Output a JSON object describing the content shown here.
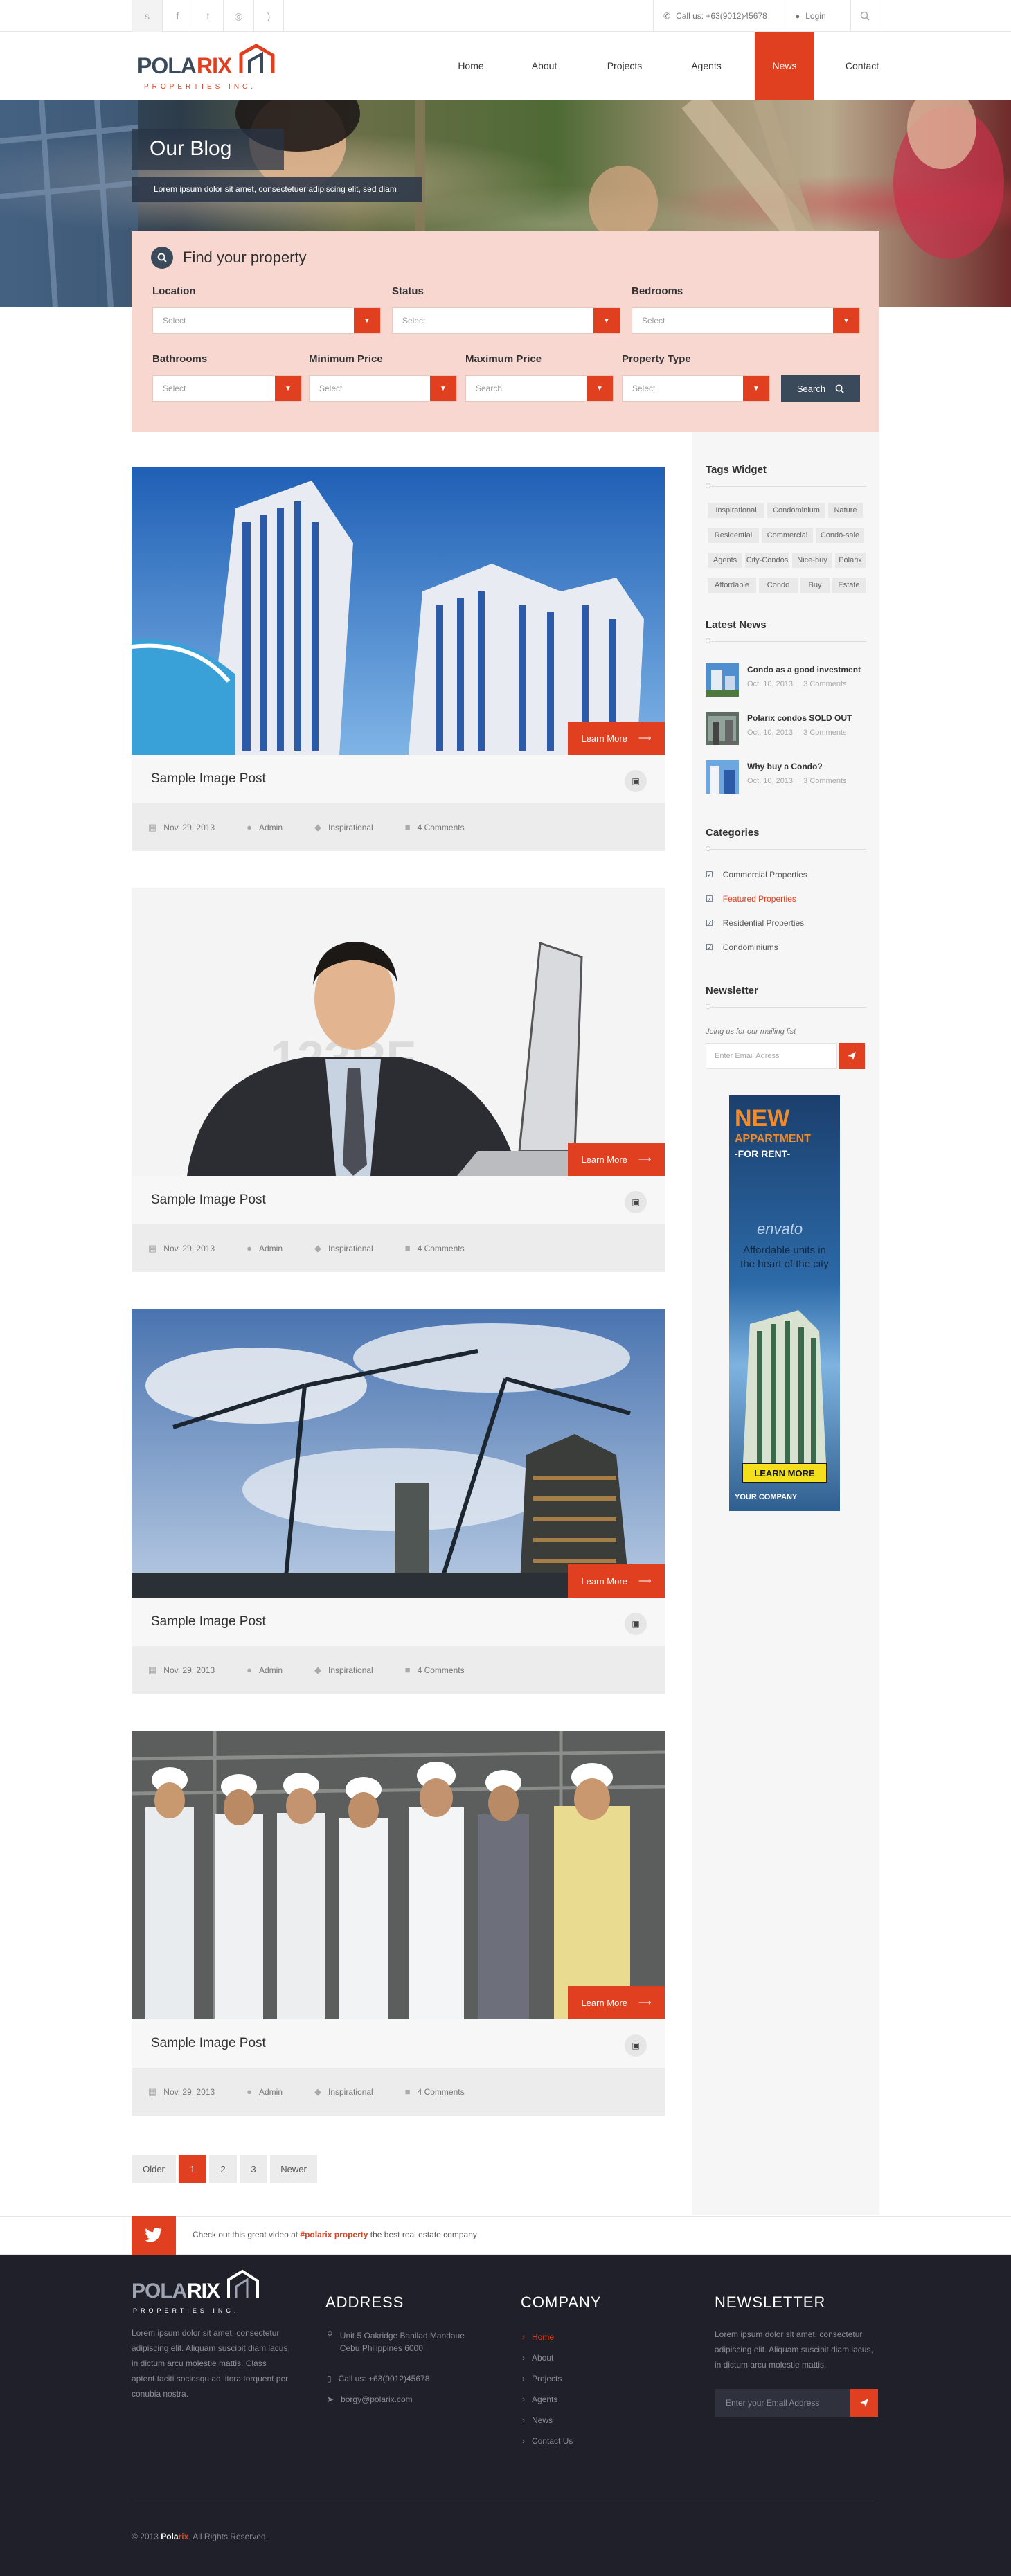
{
  "topbar": {
    "social_icons": [
      "skype-icon",
      "facebook-icon",
      "twitter-icon",
      "instagram-icon",
      "rss-icon"
    ],
    "call_label": "Call us: +63(9012)45678",
    "login_label": "Login"
  },
  "logo": {
    "name": "POLARIX",
    "sub": "PROPERTIES INC."
  },
  "nav": [
    "Home",
    "About",
    "Projects",
    "Agents",
    "News",
    "Contact"
  ],
  "hero": {
    "title": "Our Blog",
    "subtitle": "Lorem ipsum dolor sit amet, consectetuer adipiscing elit, sed diam"
  },
  "search": {
    "heading": "Find your property",
    "fields": [
      {
        "label": "Location",
        "value": "Select"
      },
      {
        "label": "Status",
        "value": "Select"
      },
      {
        "label": "Bedrooms",
        "value": "Select"
      },
      {
        "label": "Bathrooms",
        "value": "Select"
      },
      {
        "label": "Minimum Price",
        "value": "Select"
      },
      {
        "label": "Maximum Price",
        "value": "Search"
      },
      {
        "label": "Property Type",
        "value": "Select"
      }
    ],
    "button": "Search"
  },
  "posts": [
    {
      "title": "Sample Image Post",
      "learn": "Learn More",
      "date": "Nov. 29, 2013",
      "author": "Admin",
      "category": "Inspirational",
      "comments": "4 Comments"
    },
    {
      "title": "Sample Image Post",
      "learn": "Learn More",
      "date": "Nov. 29, 2013",
      "author": "Admin",
      "category": "Inspirational",
      "comments": "4 Comments"
    },
    {
      "title": "Sample Image Post",
      "learn": "Learn More",
      "date": "Nov. 29, 2013",
      "author": "Admin",
      "category": "Inspirational",
      "comments": "4 Comments"
    },
    {
      "title": "Sample Image Post",
      "learn": "Learn More",
      "date": "Nov. 29, 2013",
      "author": "Admin",
      "category": "Inspirational",
      "comments": "4 Comments"
    }
  ],
  "pagination": [
    "Older",
    "1",
    "2",
    "3",
    "Newer"
  ],
  "sidebar": {
    "tags_title": "Tags Widget",
    "tags": [
      "Inspirational",
      "Condominium",
      "Nature",
      "Residential",
      "Commercial",
      "Condo-sale",
      "Agents",
      "City-Condos",
      "Nice-buy",
      "Polarix",
      "Affordable",
      "Condo",
      "Buy",
      "Estate"
    ],
    "news_title": "Latest News",
    "news": [
      {
        "title": "Condo as a good investment",
        "date": "Oct. 10, 2013",
        "comments": "3 Comments"
      },
      {
        "title": "Polarix condos SOLD OUT",
        "date": "Oct. 10, 2013",
        "comments": "3 Comments"
      },
      {
        "title": "Why buy a Condo?",
        "date": "Oct. 10, 2013",
        "comments": "3 Comments"
      }
    ],
    "categories_title": "Categories",
    "categories": [
      "Commercial Properties",
      "Featured Properties",
      "Residential Properties",
      "Condominiums"
    ],
    "newsletter_title": "Newsletter",
    "newsletter_text": "Joing us for our mailing list",
    "newsletter_placeholder": "Enter Email Adress",
    "ad": {
      "line1": "NEW",
      "line2": "APPARTMENT",
      "line3": "-FOR RENT-",
      "brand": "envato",
      "text": "Affordable units in the heart of the city",
      "button": "LEARN MORE",
      "company": "YOUR COMPANY"
    }
  },
  "twitter": {
    "pre": "Check out this great video at ",
    "tag": "#polarix property",
    "post": " the best real estate company"
  },
  "footer": {
    "about": "Lorem ipsum dolor sit amet, consectetur adipiscing elit. Aliquam suscipit diam lacus, in dictum arcu molestie mattis. Class aptent taciti sociosqu ad litora torquent per conubia nostra.",
    "address_title": "ADDRESS",
    "address_line1": "Unit 5 Oakridge Banilad Mandaue",
    "address_line2": "Cebu Philippines 6000",
    "phone": "Call us: +63(9012)45678",
    "email": "borgy@polarix.com",
    "company_title": "COMPANY",
    "company_links": [
      "Home",
      "About",
      "Projects",
      "Agents",
      "News",
      "Contact Us"
    ],
    "newsletter_title": "NEWSLETTER",
    "newsletter_text": "Lorem ipsum dolor sit amet, consectetur adipiscing elit. Aliquam suscipit diam lacus, in dictum arcu molestie mattis.",
    "newsletter_placeholder": "Enter your Email Address",
    "copy_pre": "© 2013 ",
    "copy_brand_a": "Pola",
    "copy_brand_b": "rix",
    "copy_post": ". All Rights Reserved."
  },
  "colors": {
    "accent": "#e0401f",
    "dark": "#3b4a5b",
    "footer": "#1f2029"
  }
}
